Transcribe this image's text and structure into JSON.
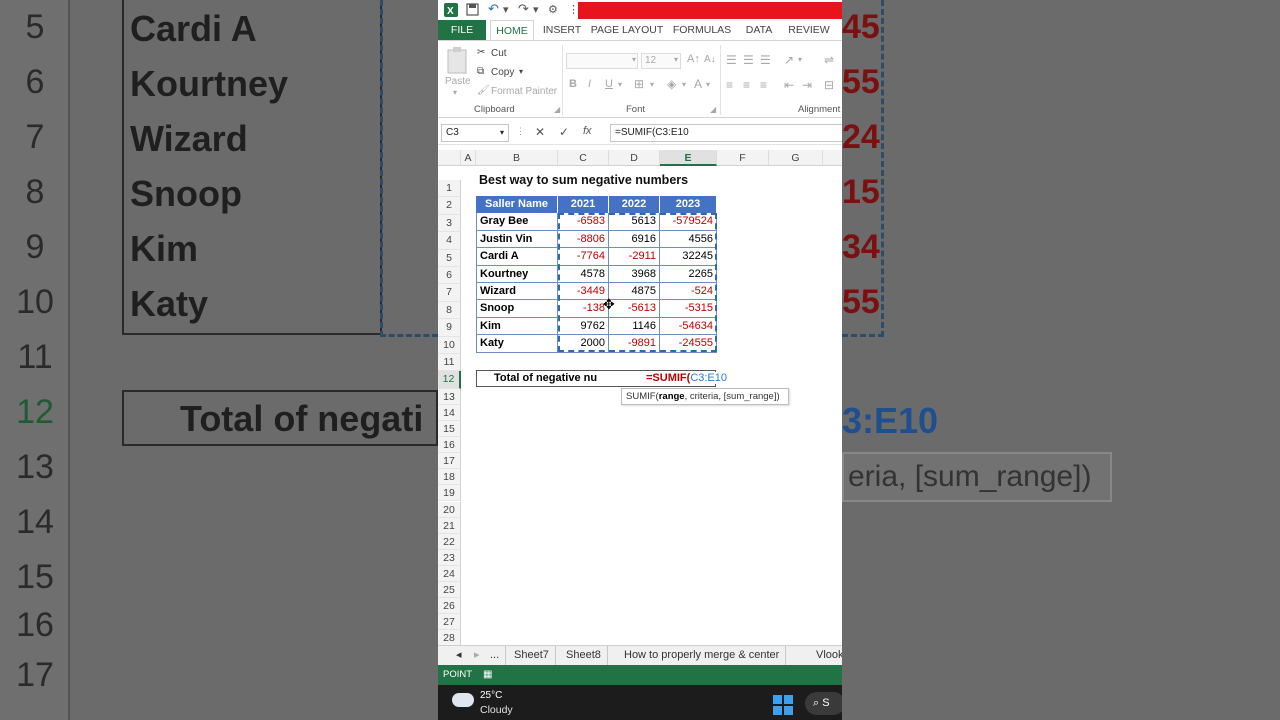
{
  "bg": {
    "rows": [
      {
        "num": "5",
        "name": "Cardi A",
        "right": "45"
      },
      {
        "num": "6",
        "name": "Kourtney",
        "right": "55"
      },
      {
        "num": "7",
        "name": "Wizard",
        "right": "24"
      },
      {
        "num": "8",
        "name": "Snoop",
        "right": "15"
      },
      {
        "num": "9",
        "name": "Kim",
        "right": "34"
      },
      {
        "num": "10",
        "name": "Katy",
        "right": "55"
      },
      {
        "num": "11",
        "name": "",
        "right": ""
      },
      {
        "num": "12",
        "name": "",
        "right": ""
      },
      {
        "num": "13",
        "name": "",
        "right": ""
      },
      {
        "num": "14",
        "name": "",
        "right": ""
      },
      {
        "num": "15",
        "name": "",
        "right": ""
      },
      {
        "num": "16",
        "name": "",
        "right": ""
      },
      {
        "num": "17",
        "name": "",
        "right": ""
      }
    ],
    "total_text": "Total of negati",
    "right_ref": "3:E10",
    "right_tip": "eria, [sum_range])"
  },
  "qat": {
    "undo": "↶",
    "redo": "↷"
  },
  "ribbon_tabs": [
    {
      "label": "FILE"
    },
    {
      "label": "HOME"
    },
    {
      "label": "INSERT"
    },
    {
      "label": "PAGE LAYOUT"
    },
    {
      "label": "FORMULAS"
    },
    {
      "label": "DATA"
    },
    {
      "label": "REVIEW"
    }
  ],
  "ribbon": {
    "paste": "Paste",
    "cut": "Cut",
    "copy": "Copy",
    "format_painter": "Format Painter",
    "font_size": "12",
    "bold": "B",
    "italic": "I",
    "underline": "U",
    "clipboard_group": "Clipboard",
    "font_group": "Font",
    "alignment_group": "Alignment"
  },
  "formula_bar": {
    "name_box": "C3",
    "cancel": "✕",
    "enter": "✓",
    "fx": "fx",
    "formula": "=SUMIF(C3:E10"
  },
  "columns": [
    "A",
    "B",
    "C",
    "D",
    "E",
    "F",
    "G"
  ],
  "rows": [
    "1",
    "2",
    "3",
    "4",
    "5",
    "6",
    "7",
    "8",
    "9",
    "10",
    "11",
    "12",
    "13",
    "14",
    "15",
    "16",
    "17",
    "18",
    "19",
    "20",
    "21",
    "22",
    "23",
    "24",
    "25",
    "26",
    "27",
    "28"
  ],
  "sheet": {
    "title": "Best way to sum negative numbers",
    "headers": [
      "Saller Name",
      "2021",
      "2022",
      "2023"
    ],
    "data": [
      {
        "name": "Gray Bee",
        "v": [
          "-6583",
          "5613",
          "-579524"
        ]
      },
      {
        "name": "Justin Vin",
        "v": [
          "-8806",
          "6916",
          "4556"
        ]
      },
      {
        "name": "Cardi A",
        "v": [
          "-7764",
          "-2911",
          "32245"
        ]
      },
      {
        "name": "Kourtney",
        "v": [
          "4578",
          "3968",
          "2265"
        ]
      },
      {
        "name": "Wizard",
        "v": [
          "-3449",
          "4875",
          "-524"
        ]
      },
      {
        "name": "Snoop",
        "v": [
          "-138",
          "-5613",
          "-5315"
        ]
      },
      {
        "name": "Kim",
        "v": [
          "9762",
          "1146",
          "-54634"
        ]
      },
      {
        "name": "Katy",
        "v": [
          "2000",
          "-9891",
          "-24555"
        ]
      }
    ],
    "total_label": "Total of negative nu",
    "formula_fn": "=SUMIF(",
    "formula_ref": "C3:E10",
    "tip_fn": "SUMIF(",
    "tip_arg": "range",
    "tip_rest": ", criteria, [sum_range])"
  },
  "sheet_tabs": [
    {
      "label": "..."
    },
    {
      "label": "Sheet7"
    },
    {
      "label": "Sheet8"
    },
    {
      "label": "How to properly merge & center"
    },
    {
      "label": "Vlook"
    }
  ],
  "status": {
    "mode": "POINT"
  },
  "taskbar": {
    "temp": "25°C",
    "condition": "Cloudy",
    "search": "S"
  },
  "colors": {
    "excel_green": "#217346",
    "header_blue": "#4472c4",
    "negative_red": "#c00000",
    "accent_red": "#e8141c"
  }
}
